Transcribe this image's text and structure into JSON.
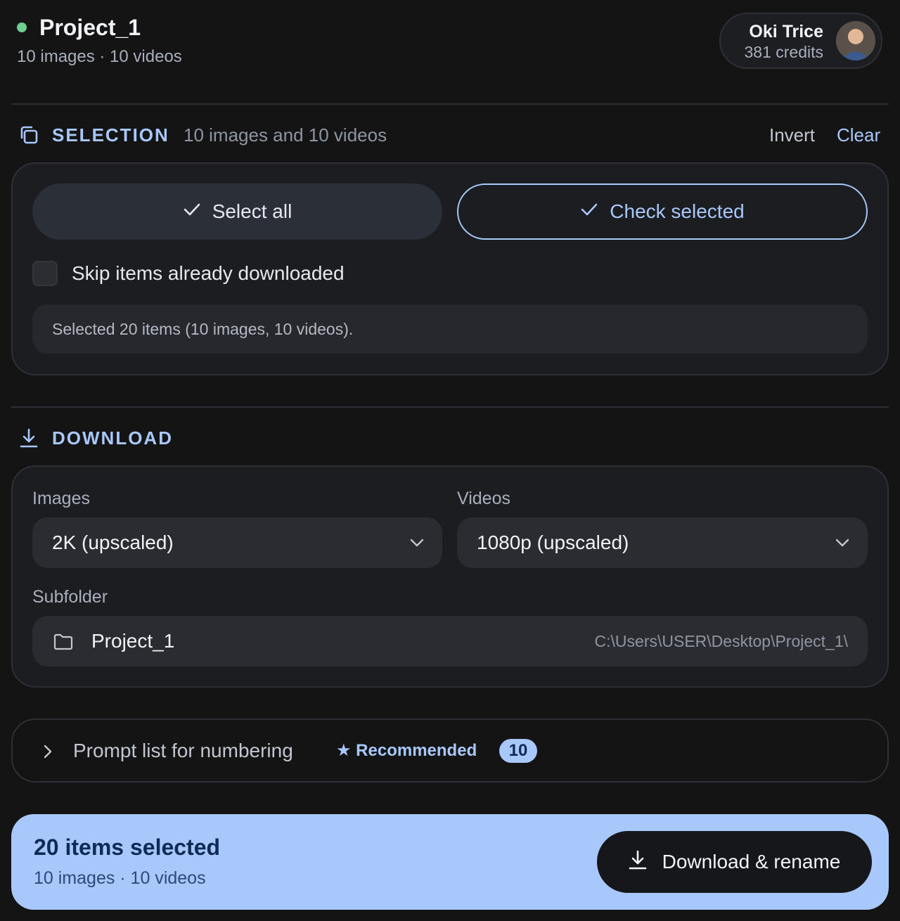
{
  "header": {
    "project_name": "Project_1",
    "project_summary": "10 images · 10 videos",
    "user_name": "Oki Trice",
    "user_credits": "381 credits"
  },
  "selection": {
    "title": "SELECTION",
    "summary": "10 images and 10 videos",
    "invert_label": "Invert",
    "clear_label": "Clear",
    "select_all_label": "Select all",
    "check_selected_label": "Check selected",
    "skip_label": "Skip items already downloaded",
    "skip_checked": false,
    "info": "Selected 20 items (10 images, 10 videos)."
  },
  "download": {
    "title": "DOWNLOAD",
    "images_label": "Images",
    "images_value": "2K (upscaled)",
    "videos_label": "Videos",
    "videos_value": "1080p (upscaled)",
    "subfolder_label": "Subfolder",
    "subfolder_value": "Project_1",
    "subfolder_path": "C:\\Users\\USER\\Desktop\\Project_1\\"
  },
  "prompt_list": {
    "label": "Prompt list for numbering",
    "recommended": "★ Recommended",
    "count": "10"
  },
  "footer": {
    "title": "20 items selected",
    "subtitle": "10 images · 10 videos",
    "action_label": "Download & rename"
  },
  "colors": {
    "background": "#141414",
    "accent": "#a8c7fa",
    "status_dot": "#6fcf8f",
    "card": "#1c1d21"
  },
  "icons": [
    "status-dot",
    "copy-icon",
    "check-icon",
    "download-icon",
    "chevron-down-icon",
    "folder-icon",
    "chevron-right-icon",
    "avatar"
  ]
}
